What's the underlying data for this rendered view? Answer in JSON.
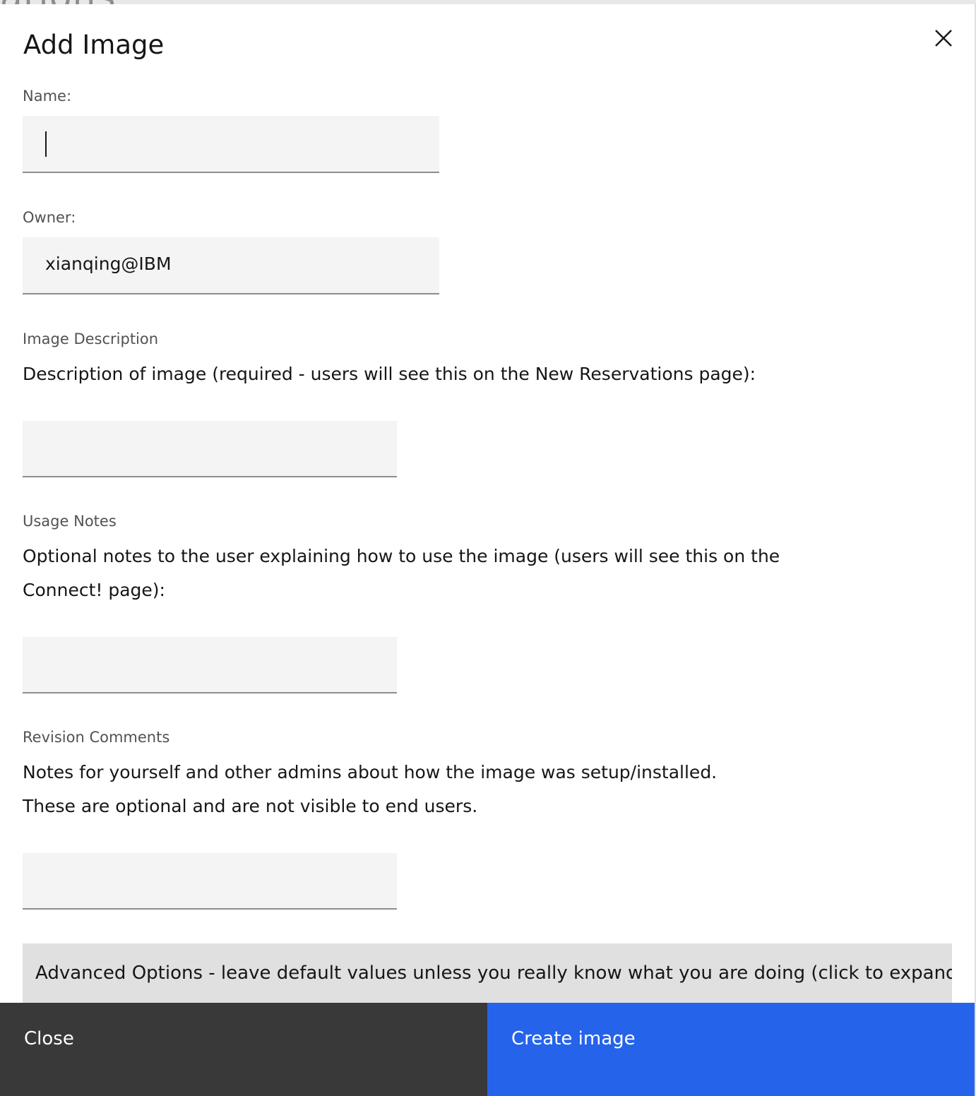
{
  "background": {
    "partial_text": "ations"
  },
  "modal": {
    "title": "Add Image",
    "close_icon": "close-icon"
  },
  "form": {
    "name": {
      "label": "Name:",
      "value": ""
    },
    "owner": {
      "label": "Owner:",
      "value": "xianqing@IBM"
    },
    "image_description": {
      "label": "Image Description",
      "help": "Description of image (required - users will see this on the New Reservations page):",
      "value": ""
    },
    "usage_notes": {
      "label": "Usage Notes",
      "help_line1": "Optional notes to the user explaining how to use the image (users will see this on the",
      "help_line2": "Connect! page):",
      "value": ""
    },
    "revision_comments": {
      "label": "Revision Comments",
      "help_line1": "Notes for yourself and other admins about how the image was setup/installed.",
      "help_line2": "These are optional and are not visible to end users.",
      "value": ""
    },
    "advanced_options": "Advanced Options - leave default values unless you really know what you are doing (click to expand)"
  },
  "footer": {
    "close_label": "Close",
    "create_label": "Create image"
  },
  "colors": {
    "primary": "#2563eb",
    "secondary": "#393939",
    "field_bg": "#f4f4f4"
  }
}
